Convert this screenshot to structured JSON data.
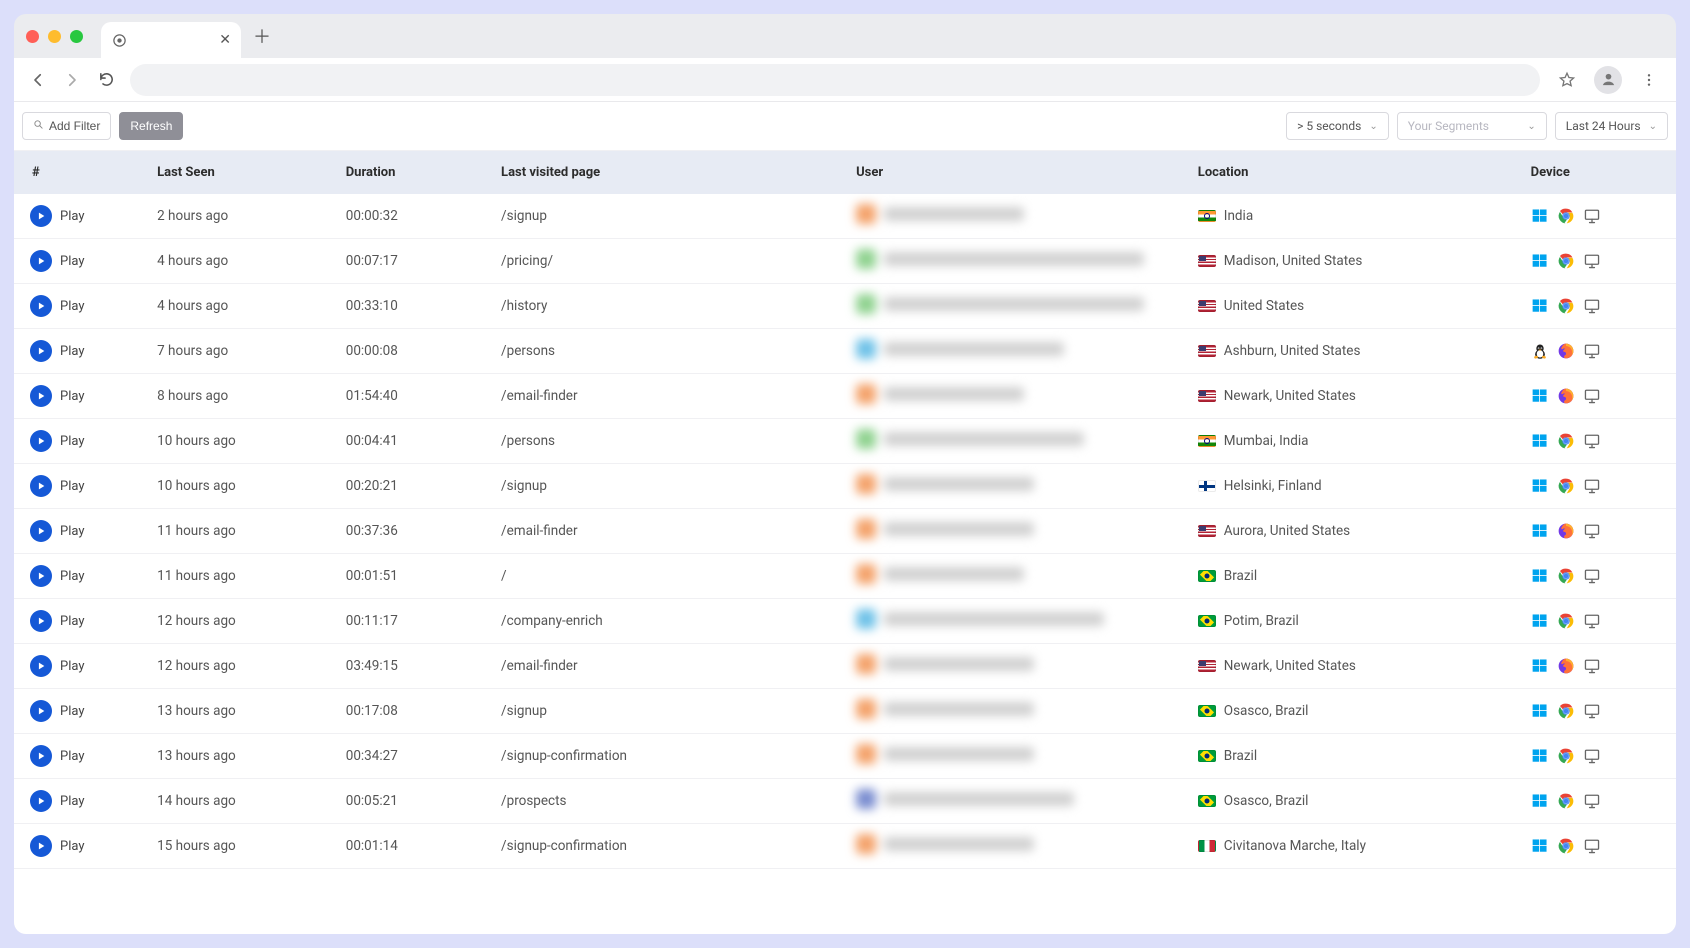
{
  "browser": {
    "new_tab_tooltip": "New Tab",
    "close_tab_tooltip": "Close"
  },
  "filters": {
    "add_filter_label": "Add Filter",
    "refresh_label": "Refresh",
    "duration_filter": "> 5 seconds",
    "segments_placeholder": "Your Segments",
    "time_range": "Last 24 Hours"
  },
  "columns": {
    "play": "#",
    "last_seen": "Last Seen",
    "duration": "Duration",
    "last_page": "Last visited page",
    "user": "User",
    "location": "Location",
    "device": "Device"
  },
  "play_label": "Play",
  "rows": [
    {
      "last_seen": "2 hours ago",
      "duration": "00:00:32",
      "page": "/signup",
      "user_color": "#f4a26a",
      "user_w": 140,
      "flag": "in",
      "location": "India",
      "os": "windows",
      "browser": "chrome",
      "device": "desktop"
    },
    {
      "last_seen": "4 hours ago",
      "duration": "00:07:17",
      "page": "/pricing/",
      "user_color": "#8fd28f",
      "user_w": 260,
      "flag": "us",
      "location": "Madison, United States",
      "os": "windows",
      "browser": "chrome",
      "device": "desktop"
    },
    {
      "last_seen": "4 hours ago",
      "duration": "00:33:10",
      "page": "/history",
      "user_color": "#8fd28f",
      "user_w": 260,
      "flag": "us",
      "location": "United States",
      "os": "windows",
      "browser": "chrome",
      "device": "desktop"
    },
    {
      "last_seen": "7 hours ago",
      "duration": "00:00:08",
      "page": "/persons",
      "user_color": "#6fc2e8",
      "user_w": 180,
      "flag": "us",
      "location": "Ashburn, United States",
      "os": "linux",
      "browser": "firefox",
      "device": "desktop"
    },
    {
      "last_seen": "8 hours ago",
      "duration": "01:54:40",
      "page": "/email-finder",
      "user_color": "#f4a26a",
      "user_w": 140,
      "flag": "us",
      "location": "Newark, United States",
      "os": "windows",
      "browser": "firefox",
      "device": "desktop"
    },
    {
      "last_seen": "10 hours ago",
      "duration": "00:04:41",
      "page": "/persons",
      "user_color": "#8fd28f",
      "user_w": 200,
      "flag": "in",
      "location": "Mumbai, India",
      "os": "windows",
      "browser": "chrome",
      "device": "desktop"
    },
    {
      "last_seen": "10 hours ago",
      "duration": "00:20:21",
      "page": "/signup",
      "user_color": "#f4a26a",
      "user_w": 150,
      "flag": "fi",
      "location": "Helsinki, Finland",
      "os": "windows",
      "browser": "chrome",
      "device": "desktop"
    },
    {
      "last_seen": "11 hours ago",
      "duration": "00:37:36",
      "page": "/email-finder",
      "user_color": "#f4a26a",
      "user_w": 150,
      "flag": "us",
      "location": "Aurora, United States",
      "os": "windows",
      "browser": "firefox",
      "device": "desktop"
    },
    {
      "last_seen": "11 hours ago",
      "duration": "00:01:51",
      "page": "/",
      "user_color": "#f4a26a",
      "user_w": 140,
      "flag": "br",
      "location": "Brazil",
      "os": "windows",
      "browser": "chrome",
      "device": "desktop"
    },
    {
      "last_seen": "12 hours ago",
      "duration": "00:11:17",
      "page": "/company-enrich",
      "user_color": "#6fc2e8",
      "user_w": 220,
      "flag": "br",
      "location": "Potim, Brazil",
      "os": "windows",
      "browser": "chrome",
      "device": "desktop"
    },
    {
      "last_seen": "12 hours ago",
      "duration": "03:49:15",
      "page": "/email-finder",
      "user_color": "#f4a26a",
      "user_w": 150,
      "flag": "us",
      "location": "Newark, United States",
      "os": "windows",
      "browser": "firefox",
      "device": "desktop"
    },
    {
      "last_seen": "13 hours ago",
      "duration": "00:17:08",
      "page": "/signup",
      "user_color": "#f4a26a",
      "user_w": 150,
      "flag": "br",
      "location": "Osasco, Brazil",
      "os": "windows",
      "browser": "chrome",
      "device": "desktop"
    },
    {
      "last_seen": "13 hours ago",
      "duration": "00:34:27",
      "page": "/signup-confirmation",
      "user_color": "#f4a26a",
      "user_w": 150,
      "flag": "br",
      "location": "Brazil",
      "os": "windows",
      "browser": "chrome",
      "device": "desktop"
    },
    {
      "last_seen": "14 hours ago",
      "duration": "00:05:21",
      "page": "/prospects",
      "user_color": "#7a8dd0",
      "user_w": 190,
      "flag": "br",
      "location": "Osasco, Brazil",
      "os": "windows",
      "browser": "chrome",
      "device": "desktop"
    },
    {
      "last_seen": "15 hours ago",
      "duration": "00:01:14",
      "page": "/signup-confirmation",
      "user_color": "#f4a26a",
      "user_w": 150,
      "flag": "it",
      "location": "Civitanova Marche, Italy",
      "os": "windows",
      "browser": "chrome",
      "device": "desktop"
    }
  ]
}
